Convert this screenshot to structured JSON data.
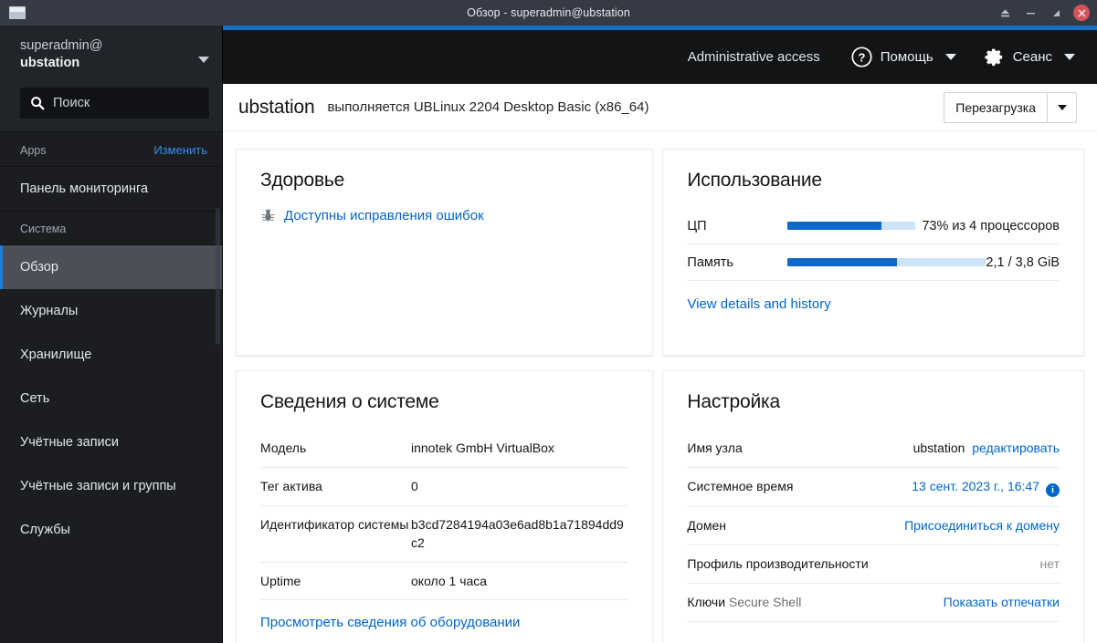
{
  "window": {
    "title": "Обзор - superadmin@ubstation",
    "app_icon": "window-icon",
    "controls": [
      {
        "name": "eject-icon",
        "label": "⏏"
      },
      {
        "name": "minimize-icon",
        "label": "—"
      },
      {
        "name": "restore-icon",
        "label": "❐"
      },
      {
        "name": "close-icon",
        "label": "✕"
      }
    ]
  },
  "sidebar": {
    "account": {
      "user": "superadmin@",
      "host": "ubstation",
      "caret_icon": "chevron-down-icon"
    },
    "search": {
      "placeholder": "Поиск",
      "value": "",
      "icon": "search-icon"
    },
    "apps_section": {
      "label": "Apps",
      "action": "Изменить"
    },
    "apps_items": [
      {
        "label": "Панель мониторинга",
        "active": false
      }
    ],
    "system_section": {
      "label": "Система"
    },
    "system_items": [
      {
        "label": "Обзор",
        "active": true
      },
      {
        "label": "Журналы",
        "active": false
      },
      {
        "label": "Хранилище",
        "active": false
      },
      {
        "label": "Сеть",
        "active": false
      },
      {
        "label": "Учётные записи",
        "active": false
      },
      {
        "label": "Учётные записи и группы",
        "active": false
      },
      {
        "label": "Службы",
        "active": false
      }
    ]
  },
  "topbar": {
    "admin_access": "Administrative access",
    "help": {
      "label": "Помощь",
      "icon": "help-circle-icon",
      "caret": "chevron-down-icon"
    },
    "session": {
      "label": "Сеанс",
      "icon": "gear-icon",
      "caret": "chevron-down-icon"
    }
  },
  "page_header": {
    "hostname": "ubstation",
    "subtitle": "выполняется UBLinux 2204 Desktop Basic (x86_64)",
    "reboot_button": "Перезагрузка",
    "reboot_caret": "chevron-down-icon"
  },
  "health": {
    "title": "Здоровье",
    "icon": "bug-icon",
    "link": "Доступны исправления ошибок"
  },
  "usage": {
    "title": "Использование",
    "rows": [
      {
        "label": "ЦП",
        "value": "73% из 4 процессоров",
        "percent": 73
      },
      {
        "label": "Память",
        "value": "2,1 / 3,8 GiB",
        "percent": 55
      }
    ],
    "details_link": "View details and history"
  },
  "system_info": {
    "title": "Сведения о системе",
    "rows": [
      {
        "label": "Модель",
        "value": "innotek GmbH VirtualBox"
      },
      {
        "label": "Тег актива",
        "value": "0"
      },
      {
        "label": "Идентификатор системы",
        "value": "b3cd7284194a03e6ad8b1a71894dd9c2"
      },
      {
        "label": "Uptime",
        "value": "около 1 часа"
      }
    ],
    "footer_link": "Просмотреть сведения об оборудовании"
  },
  "configuration": {
    "title": "Настройка",
    "hostname_label": "Имя узла",
    "hostname_value": "ubstation",
    "hostname_edit": "редактировать",
    "systime_label": "Системное время",
    "systime_value": "13 сент. 2023 г., 16:47",
    "systime_info_icon": "info-icon",
    "domain_label": "Домен",
    "domain_link": "Присоединиться к домену",
    "perf_label": "Профиль производительности",
    "perf_value": "нет",
    "ssh_label_strong": "Ключи",
    "ssh_label_rest": "Secure Shell",
    "ssh_link": "Показать отпечатки"
  },
  "colors": {
    "accent_blue": "#1a72c4",
    "link_blue": "#06c",
    "progress_fill": "#0d68c9",
    "progress_track": "#cfe3f7",
    "close_red": "#d5525a",
    "sidebar_bg": "#1b1d21",
    "titlebar_bg": "#353a45"
  }
}
